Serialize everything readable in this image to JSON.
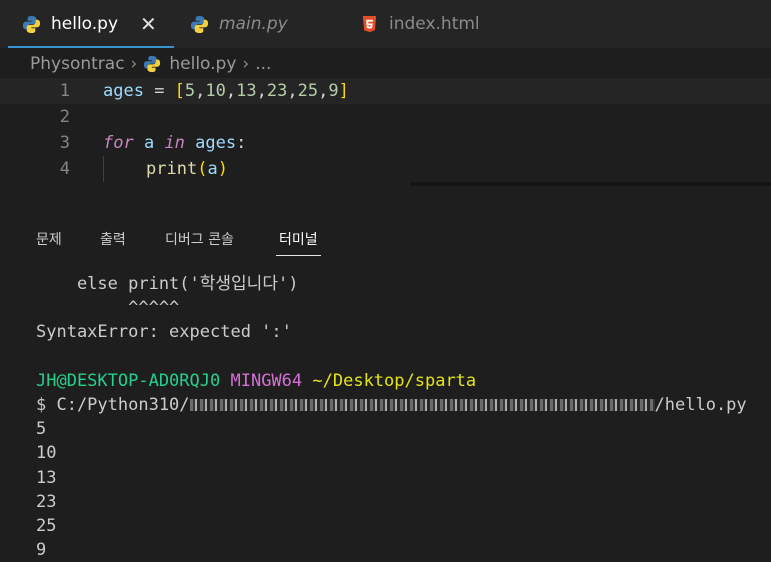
{
  "tabs": [
    {
      "label": "hello.py",
      "icon": "python-icon",
      "active": true,
      "close": "✕"
    },
    {
      "label": "main.py",
      "icon": "python-icon",
      "active": false
    },
    {
      "label": "index.html",
      "icon": "html5-icon",
      "active": false
    }
  ],
  "breadcrumb": {
    "folder": "Physontrac",
    "file": "hello.py",
    "more": "..."
  },
  "editor": {
    "lines": [
      {
        "n": "1"
      },
      {
        "n": "2"
      },
      {
        "n": "3"
      },
      {
        "n": "4"
      }
    ],
    "tokens": {
      "l1_var": "ages",
      "l1_eq": " = ",
      "l1_open": "[",
      "l1_n1": "5",
      "l1_c1": ",",
      "l1_n2": "10",
      "l1_c2": ",",
      "l1_n3": "13",
      "l1_c3": ",",
      "l1_n4": "23",
      "l1_c4": ",",
      "l1_n5": "25",
      "l1_c5": ",",
      "l1_n6": "9",
      "l1_close": "]",
      "l3_for": "for",
      "l3_a": " a ",
      "l3_in": "in",
      "l3_ages": " ages",
      "l3_colon": ":",
      "l4_print": "print",
      "l4_open": "(",
      "l4_a": "a",
      "l4_close": ")"
    }
  },
  "panel": {
    "tabs": [
      "문제",
      "출력",
      "디버그 콘솔",
      "터미널"
    ],
    "active": "터미널"
  },
  "terminal": {
    "l1": "    else print('학생입니다')",
    "l2": "         ^^^^^",
    "l3": "SyntaxError: expected ':'",
    "prompt_user": "JH@DESKTOP-AD0RQJ0",
    "prompt_env": "MINGW64",
    "prompt_path": "~/Desktop/sparta",
    "cmd_prefix": "$ C:/Python310/",
    "cmd_suffix": "/hello.py",
    "output": [
      "5",
      "10",
      "13",
      "23",
      "25",
      "9"
    ]
  },
  "colors": {
    "accent": "#3794d1",
    "bg": "#1e1e1e",
    "green": "#23d18b",
    "magenta": "#d670d6",
    "yellow": "#e5e510"
  }
}
